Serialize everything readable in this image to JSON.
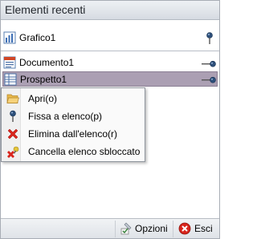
{
  "panel": {
    "title": "Elementi recenti"
  },
  "items": [
    {
      "label": "Grafico1",
      "icon": "chart-icon",
      "pinned": true
    },
    {
      "label": "Documento1",
      "icon": "document-icon",
      "pinned": false
    },
    {
      "label": "Prospetto1",
      "icon": "spreadsheet-icon",
      "pinned": false
    }
  ],
  "context_menu": {
    "items": [
      {
        "label": "Apri(o)",
        "icon": "folder-open-icon"
      },
      {
        "label": "Fissa a elenco(p)",
        "icon": "pin-icon"
      },
      {
        "label": "Elimina dall'elenco(r)",
        "icon": "delete-x-icon"
      },
      {
        "label": "Cancella elenco sbloccato",
        "icon": "clear-list-icon"
      }
    ]
  },
  "footer": {
    "options_label": "Opzioni",
    "exit_label": "Esci"
  },
  "colors": {
    "selected_row": "#ab9fb3",
    "header_bg": "#d6dbe2",
    "delete_red": "#d8251d"
  }
}
